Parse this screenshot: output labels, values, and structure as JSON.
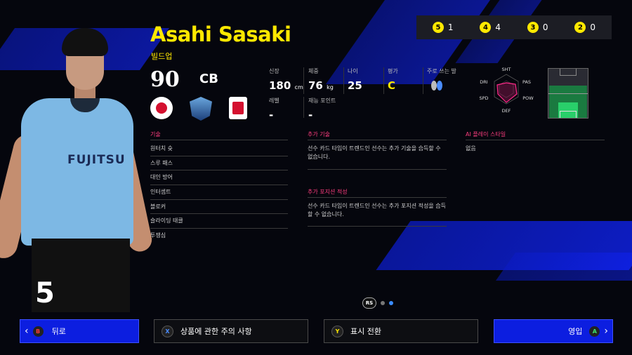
{
  "player": {
    "name": "Asahi Sasaki",
    "playing_style": "빌드업",
    "overall": "90",
    "position": "CB",
    "shirt_number": "5",
    "jersey_sponsor": "FUJITSU"
  },
  "stats": {
    "height": {
      "label": "신장",
      "value": "180",
      "unit": "cm"
    },
    "weight": {
      "label": "체중",
      "value": "76",
      "unit": "kg"
    },
    "age": {
      "label": "나이",
      "value": "25"
    },
    "rating": {
      "label": "평가",
      "value": "C"
    },
    "foot": {
      "label": "주로 쓰는 발"
    },
    "level": {
      "label": "레벨",
      "value": "-"
    },
    "skill_points": {
      "label": "재능 포인트",
      "value": "-"
    }
  },
  "ranks": [
    {
      "badge": "5",
      "count": "1"
    },
    {
      "badge": "4",
      "count": "4"
    },
    {
      "badge": "3",
      "count": "0"
    },
    {
      "badge": "2",
      "count": "0"
    }
  ],
  "radar": {
    "labels": [
      "SHT",
      "PAS",
      "POW",
      "DEF",
      "SPD",
      "DRI"
    ]
  },
  "skills": {
    "title": "기술",
    "items": [
      "원터치 슛",
      "스루 패스",
      "대인 방어",
      "인터셉트",
      "블로커",
      "슬라이딩 태클",
      "투쟁심"
    ]
  },
  "additional_skills": {
    "title": "추가 기술",
    "text": "선수 카드 타입이 트렌드인 선수는 추가 기술을 습득할 수 없습니다."
  },
  "additional_positions": {
    "title": "추가 포지션 적성",
    "text": "선수 카드 타입이 트렌드인 선수는 추가 포지션 적성을 습득할 수 없습니다."
  },
  "ai_styles": {
    "title": "AI 플레이 스타일",
    "text": "없음"
  },
  "pager": {
    "label": "RS"
  },
  "buttons": {
    "back": {
      "key": "B",
      "label": "뒤로"
    },
    "notice": {
      "key": "X",
      "label": "상품에 관한 주의 사항"
    },
    "toggle": {
      "key": "Y",
      "label": "표시 전환"
    },
    "sign": {
      "key": "A",
      "label": "영입"
    }
  },
  "colors": {
    "accent_yellow": "#ffe800",
    "section_pink": "#ff3d7f",
    "button_blue": "#0c1ee0",
    "pitch_green": "#29cf6a"
  }
}
